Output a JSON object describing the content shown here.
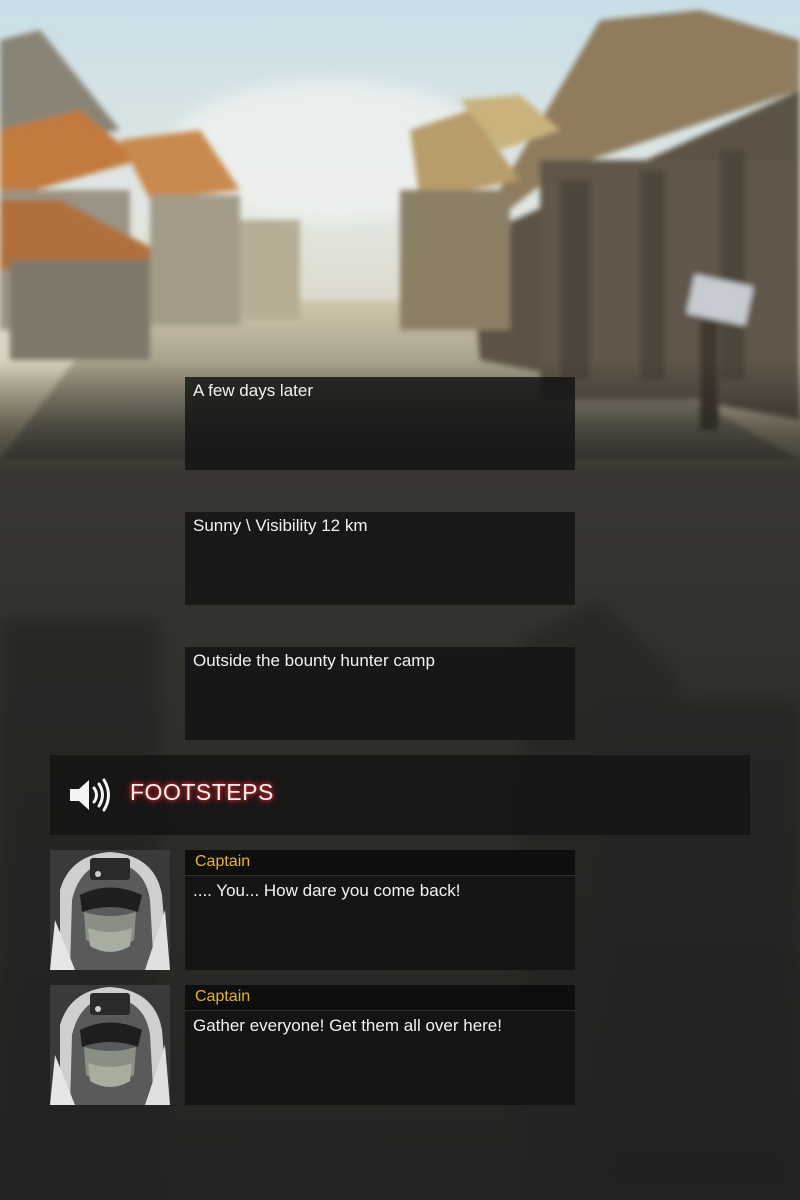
{
  "narrations": [
    {
      "text": "A few days later"
    },
    {
      "text": "Sunny \\ Visibility 12 km"
    },
    {
      "text": "Outside the bounty hunter camp"
    }
  ],
  "sound_effect": {
    "icon": "speaker-icon",
    "label": "FOOTSTEPS",
    "glow_color": "#c0282a"
  },
  "dialogue": [
    {
      "speaker": "Captain",
      "text": ".... You... How dare you come back!",
      "portrait": "captain-portrait"
    },
    {
      "speaker": "Captain",
      "text": "Gather everyone! Get them all over here!",
      "portrait": "captain-portrait"
    }
  ],
  "colors": {
    "speaker_name": "#e8b530",
    "text": "#f2f2f2",
    "panel": "#121212"
  }
}
